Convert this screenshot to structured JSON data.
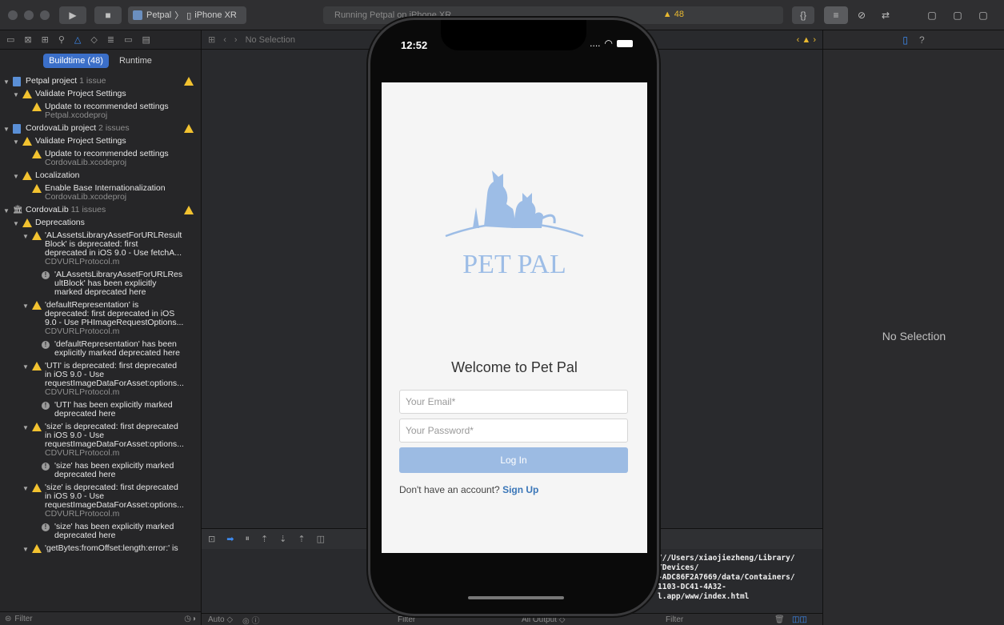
{
  "toolbar": {
    "scheme": "Petpal",
    "device": "iPhone XR",
    "activity": "Running Petpal on iPhone XR",
    "warning_count": "48"
  },
  "navigator": {
    "tabs": {
      "buildtime": "Buildtime (48)",
      "runtime": "Runtime"
    },
    "filter_placeholder": "Filter",
    "rows": [
      {
        "indent": 0,
        "tri": true,
        "icon": "file",
        "text": "Petpal project",
        "count": "1 issue",
        "rightwarn": true
      },
      {
        "indent": 1,
        "tri": true,
        "icon": "warn",
        "text": "Validate Project Settings"
      },
      {
        "indent": 2,
        "icon": "warn",
        "text": "Update to recommended settings",
        "sub": "Petpal.xcodeproj"
      },
      {
        "indent": 0,
        "tri": true,
        "icon": "file",
        "text": "CordovaLib project",
        "count": "2 issues",
        "rightwarn": true
      },
      {
        "indent": 1,
        "tri": true,
        "icon": "warn",
        "text": "Validate Project Settings"
      },
      {
        "indent": 2,
        "icon": "warn",
        "text": "Update to recommended settings",
        "sub": "CordovaLib.xcodeproj"
      },
      {
        "indent": 1,
        "tri": true,
        "icon": "warn",
        "text": "Localization"
      },
      {
        "indent": 2,
        "icon": "warn",
        "text": "Enable Base Internationalization",
        "sub": "CordovaLib.xcodeproj"
      },
      {
        "indent": 0,
        "tri": true,
        "icon": "lib",
        "text": "CordovaLib",
        "count": "11 issues",
        "rightwarn": true
      },
      {
        "indent": 1,
        "tri": true,
        "icon": "warn",
        "text": "Deprecations"
      },
      {
        "indent": 2,
        "tri": true,
        "icon": "warn",
        "lines": [
          "'ALAssetsLibraryAssetForURLResult",
          "Block' is deprecated: first",
          "deprecated in iOS 9.0 - Use fetchA..."
        ],
        "sub": "CDVURLProtocol.m"
      },
      {
        "indent": 3,
        "icon": "note",
        "lines": [
          "'ALAssetsLibraryAssetForURLRes",
          "ultBlock' has been explicitly",
          "marked deprecated here"
        ]
      },
      {
        "indent": 2,
        "tri": true,
        "icon": "warn",
        "lines": [
          "'defaultRepresentation' is",
          "deprecated: first deprecated in iOS",
          "9.0 - Use PHImageRequestOptions..."
        ],
        "sub": "CDVURLProtocol.m"
      },
      {
        "indent": 3,
        "icon": "note",
        "lines": [
          "'defaultRepresentation' has been",
          "explicitly marked deprecated here"
        ]
      },
      {
        "indent": 2,
        "tri": true,
        "icon": "warn",
        "lines": [
          "'UTI' is deprecated: first deprecated",
          "in iOS 9.0 - Use",
          "requestImageDataForAsset:options..."
        ],
        "sub": "CDVURLProtocol.m"
      },
      {
        "indent": 3,
        "icon": "note",
        "lines": [
          "'UTI' has been explicitly marked",
          "deprecated here"
        ]
      },
      {
        "indent": 2,
        "tri": true,
        "icon": "warn",
        "lines": [
          "'size' is deprecated: first deprecated",
          "in iOS 9.0 - Use",
          "requestImageDataForAsset:options..."
        ],
        "sub": "CDVURLProtocol.m"
      },
      {
        "indent": 3,
        "icon": "note",
        "lines": [
          "'size' has been explicitly marked",
          "deprecated here"
        ]
      },
      {
        "indent": 2,
        "tri": true,
        "icon": "warn",
        "lines": [
          "'size' is deprecated: first deprecated",
          "in iOS 9.0 - Use",
          "requestImageDataForAsset:options..."
        ],
        "sub": "CDVURLProtocol.m"
      },
      {
        "indent": 3,
        "icon": "note",
        "lines": [
          "'size' has been explicitly marked",
          "deprecated here"
        ]
      },
      {
        "indent": 2,
        "tri": true,
        "icon": "warn",
        "lines": [
          "'getBytes:fromOffset:length:error:' is"
        ]
      }
    ]
  },
  "editor": {
    "jumpbar": "No Selection",
    "console_lines": [
      "///Users/xiaojiezheng/Library/",
      "/Devices/",
      "-ADC86F2A7669/data/Containers/",
      "1103-DC41-4A32-",
      "l.app/www/index.html"
    ],
    "bottom": {
      "auto": "Auto ◇",
      "filter": "Filter",
      "all_output": "All Output ◇",
      "filter2": "Filter"
    }
  },
  "inspector": {
    "empty": "No Selection"
  },
  "phone": {
    "time": "12:52",
    "logo_text": "PET PAL",
    "welcome": "Welcome to Pet Pal",
    "email_placeholder": "Your Email*",
    "password_placeholder": "Your Password*",
    "login_label": "Log In",
    "signup_prompt": "Don't have an account?",
    "signup_link": "Sign Up"
  },
  "colors": {
    "accent": "#3e8ef7",
    "warning": "#f2c230",
    "login_button": "#9cbbe3",
    "logo": "#9dbde6",
    "signup_link": "#3a76b8"
  }
}
